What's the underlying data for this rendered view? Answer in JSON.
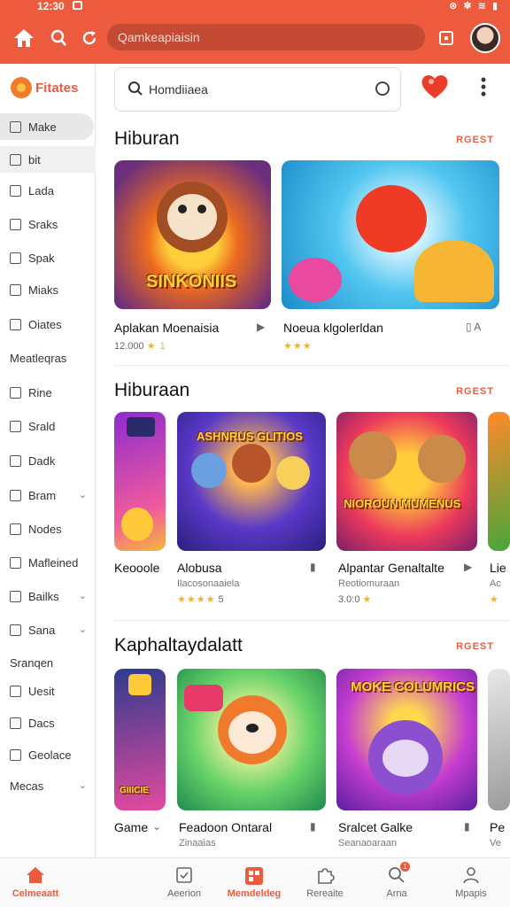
{
  "status": {
    "time": "12:30",
    "icons": "⊗ ✽ ≋ ▮"
  },
  "topbar": {
    "url_text": "Qamkeapiaisin"
  },
  "sidebar": {
    "brand": "Fitates",
    "items": [
      {
        "label": "Make",
        "icon": "square-icon"
      },
      {
        "label": "bit",
        "icon": "square-icon"
      },
      {
        "label": "Lada",
        "icon": "square-icon"
      },
      {
        "label": "Sraks",
        "icon": "square-icon"
      },
      {
        "label": "Spak",
        "icon": "edit-icon"
      },
      {
        "label": "Miaks",
        "icon": "square-icon"
      },
      {
        "label": "Oiates",
        "icon": "edit-icon"
      },
      {
        "label": "Meatleqras",
        "icon": ""
      },
      {
        "label": "Rine",
        "icon": "check-icon"
      },
      {
        "label": "Srald",
        "icon": "check-icon"
      },
      {
        "label": "Dadk",
        "icon": "edit-icon"
      },
      {
        "label": "Bram",
        "icon": "check-icon"
      },
      {
        "label": "Nodes",
        "icon": "check-icon"
      },
      {
        "label": "Mafleined",
        "icon": "mail-icon"
      },
      {
        "label": "Bailks",
        "icon": "link-icon"
      },
      {
        "label": "Sana",
        "icon": "car-icon"
      },
      {
        "label": "Sranqen",
        "icon": ""
      },
      {
        "label": "Uesit",
        "icon": "check-icon"
      },
      {
        "label": "Dacs",
        "icon": "square-icon"
      },
      {
        "label": "Geolace",
        "icon": "columns-icon"
      },
      {
        "label": "Mecas",
        "icon": ""
      }
    ]
  },
  "search": {
    "text": "Homdiiaea"
  },
  "sections": [
    {
      "title": "Hiburan",
      "more": "RGEST",
      "cards": [
        {
          "art_text": "SINKONIIS",
          "title": "Aplakan Moenaisia",
          "meta": "12.000",
          "rating": "★ 1"
        },
        {
          "art_text": "",
          "title": "Noeua klgolerldan",
          "meta": "",
          "rating": "★★★"
        }
      ]
    },
    {
      "title": "Hiburaan",
      "more": "RGEST",
      "cards": [
        {
          "art_text": "",
          "title": "Keooole",
          "sub": "",
          "meta": ""
        },
        {
          "art_text": "ASHNRUS GLITIOS",
          "title": "Alobusa",
          "sub": "Ilacosonaaiela",
          "rating": "★★★★",
          "meta": "5"
        },
        {
          "art_text": "NIOROUN MUMENUS",
          "title": "Alpantar Genaltalte",
          "sub": "Reotiomuraan",
          "rating": "★",
          "meta": "3.0:0"
        },
        {
          "art_text": "",
          "title": "Lie",
          "sub": "Ac",
          "rating": "★"
        }
      ]
    },
    {
      "title": "Kaphaltaydalatt",
      "more": "RGEST",
      "cards": [
        {
          "art_text": "GIIICIE",
          "title": "Game",
          "sub": ""
        },
        {
          "art_text": "",
          "title": "Feadoon Ontaral",
          "sub": "Zinaaias"
        },
        {
          "art_text": "MOKE COLUMRICS",
          "title": "Sralcet Galke",
          "sub": "Seanaoaraan"
        },
        {
          "art_text": "",
          "title": "Pe",
          "sub": "Ve"
        }
      ]
    }
  ],
  "bottomnav": [
    {
      "label": "Celmeaatt",
      "icon": "home-icon",
      "active": true
    },
    {
      "label": "Aeerion",
      "icon": "check-square-icon"
    },
    {
      "label": "Memdeldeg",
      "icon": "grid-icon",
      "active": true
    },
    {
      "label": "Rereaite",
      "icon": "puzzle-icon"
    },
    {
      "label": "Arna",
      "icon": "search-icon",
      "badge": "1"
    },
    {
      "label": "Mpapis",
      "icon": "person-icon"
    }
  ],
  "colors": {
    "accent": "#ec5b3d",
    "topbar": "#ec5b3d",
    "star": "#f4b324"
  }
}
